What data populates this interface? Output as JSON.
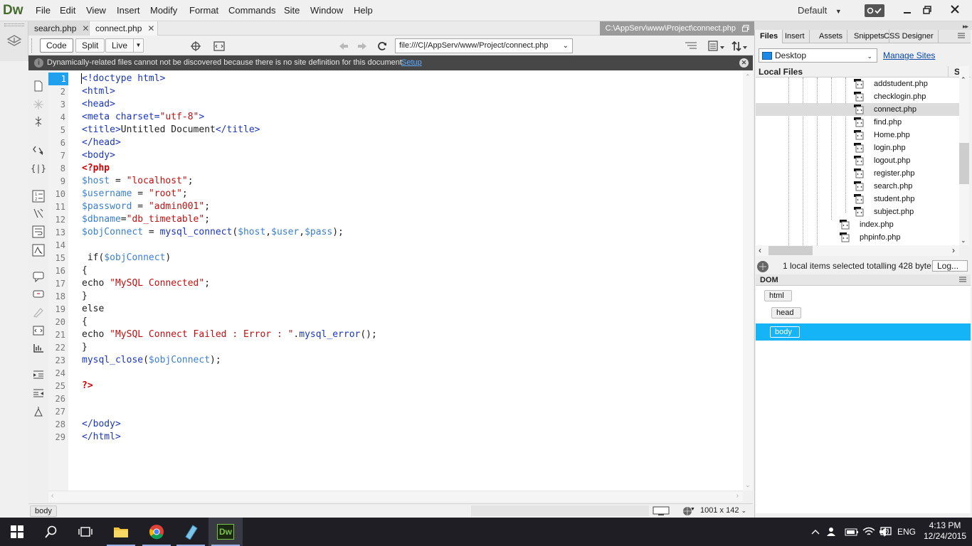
{
  "app": {
    "logo": "Dw"
  },
  "menu": [
    "File",
    "Edit",
    "View",
    "Insert",
    "Modify",
    "Format",
    "Commands",
    "Site",
    "Window",
    "Help"
  ],
  "workspace": {
    "label": "Default"
  },
  "tabs": [
    {
      "label": "search.php",
      "active": false
    },
    {
      "label": "connect.php",
      "active": true
    }
  ],
  "filepath": "C:\\AppServ\\www\\Project\\connect.php",
  "toolbar": {
    "code_label": "Code",
    "split_label": "Split",
    "live_label": "Live",
    "address": "file:///C|/AppServ/www/Project/connect.php"
  },
  "infobar": {
    "message": "Dynamically-related files cannot not be discovered because there is no site definition for this document.",
    "link": "Setup"
  },
  "editor": {
    "current_line": 1,
    "line_numbers": [
      "1",
      "2",
      "3",
      "4",
      "5",
      "6",
      "7",
      "8",
      "9",
      "10",
      "11",
      "12",
      "13",
      "14",
      "15",
      "16",
      "17",
      "18",
      "19",
      "20",
      "21",
      "22",
      "23",
      "24",
      "25",
      "26",
      "27",
      "28",
      "29"
    ],
    "lines": [
      [
        {
          "t": "<!doctype html>",
          "c": "tag"
        }
      ],
      [
        {
          "t": "<html>",
          "c": "tag"
        }
      ],
      [
        {
          "t": "<head>",
          "c": "tag"
        }
      ],
      [
        {
          "t": "<meta charset=",
          "c": "tag"
        },
        {
          "t": "\"utf-8\"",
          "c": "str"
        },
        {
          "t": ">",
          "c": "tag"
        }
      ],
      [
        {
          "t": "<title>",
          "c": "tag"
        },
        {
          "t": "Untitled Document",
          "c": "plain"
        },
        {
          "t": "</title>",
          "c": "tag"
        }
      ],
      [
        {
          "t": "</head>",
          "c": "tag"
        }
      ],
      [
        {
          "t": "<body>",
          "c": "tag"
        }
      ],
      [
        {
          "t": "<?php",
          "c": "php"
        }
      ],
      [
        {
          "t": "$host",
          "c": "var"
        },
        {
          "t": " = ",
          "c": "plain"
        },
        {
          "t": "\"localhost\"",
          "c": "str"
        },
        {
          "t": ";",
          "c": "plain"
        }
      ],
      [
        {
          "t": "$username",
          "c": "var"
        },
        {
          "t": " = ",
          "c": "plain"
        },
        {
          "t": "\"root\"",
          "c": "str"
        },
        {
          "t": ";",
          "c": "plain"
        }
      ],
      [
        {
          "t": "$password",
          "c": "var"
        },
        {
          "t": " = ",
          "c": "plain"
        },
        {
          "t": "\"admin001\"",
          "c": "str"
        },
        {
          "t": ";",
          "c": "plain"
        }
      ],
      [
        {
          "t": "$dbname",
          "c": "var"
        },
        {
          "t": "=",
          "c": "plain"
        },
        {
          "t": "\"db_timetable\"",
          "c": "str"
        },
        {
          "t": ";",
          "c": "plain"
        }
      ],
      [
        {
          "t": "$objConnect",
          "c": "var"
        },
        {
          "t": " = ",
          "c": "plain"
        },
        {
          "t": "mysql_connect",
          "c": "fn"
        },
        {
          "t": "(",
          "c": "plain"
        },
        {
          "t": "$host",
          "c": "var"
        },
        {
          "t": ",",
          "c": "plain"
        },
        {
          "t": "$user",
          "c": "var"
        },
        {
          "t": ",",
          "c": "plain"
        },
        {
          "t": "$pass",
          "c": "var"
        },
        {
          "t": ");",
          "c": "plain"
        }
      ],
      [],
      [
        {
          "t": " if(",
          "c": "plain"
        },
        {
          "t": "$objConnect",
          "c": "var"
        },
        {
          "t": ")",
          "c": "plain"
        }
      ],
      [
        {
          "t": "{",
          "c": "plain"
        }
      ],
      [
        {
          "t": "echo ",
          "c": "plain"
        },
        {
          "t": "\"MySQL Connected\"",
          "c": "str"
        },
        {
          "t": ";",
          "c": "plain"
        }
      ],
      [
        {
          "t": "}",
          "c": "plain"
        }
      ],
      [
        {
          "t": "else",
          "c": "plain"
        }
      ],
      [
        {
          "t": "{",
          "c": "plain"
        }
      ],
      [
        {
          "t": "echo ",
          "c": "plain"
        },
        {
          "t": "\"MySQL Connect Failed : Error : \"",
          "c": "str"
        },
        {
          "t": ".",
          "c": "plain"
        },
        {
          "t": "mysql_error",
          "c": "fn"
        },
        {
          "t": "();",
          "c": "plain"
        }
      ],
      [
        {
          "t": "}",
          "c": "plain"
        }
      ],
      [
        {
          "t": "mysql_close",
          "c": "fn"
        },
        {
          "t": "(",
          "c": "plain"
        },
        {
          "t": "$objConnect",
          "c": "var"
        },
        {
          "t": ");",
          "c": "plain"
        }
      ],
      [],
      [
        {
          "t": "?>",
          "c": "php"
        }
      ],
      [],
      [],
      [
        {
          "t": "</body>",
          "c": "tag"
        }
      ],
      [
        {
          "t": "</html>",
          "c": "tag"
        }
      ]
    ]
  },
  "status": {
    "tag": "body",
    "dimensions": "1001 x 142"
  },
  "panel": {
    "tabs": [
      "Files",
      "Insert",
      "Assets",
      "Snippets",
      "CSS Designer"
    ],
    "site": "Desktop",
    "manage_sites": "Manage Sites",
    "local_files_header": "Local Files",
    "size_header": "S",
    "files": [
      {
        "name": "addstudent.php",
        "selected": false,
        "indent": 2
      },
      {
        "name": "checklogin.php",
        "selected": false,
        "indent": 2
      },
      {
        "name": "connect.php",
        "selected": true,
        "indent": 2
      },
      {
        "name": "find.php",
        "selected": false,
        "indent": 2
      },
      {
        "name": "Home.php",
        "selected": false,
        "indent": 2
      },
      {
        "name": "login.php",
        "selected": false,
        "indent": 2
      },
      {
        "name": "logout.php",
        "selected": false,
        "indent": 2
      },
      {
        "name": "register.php",
        "selected": false,
        "indent": 2
      },
      {
        "name": "search.php",
        "selected": false,
        "indent": 2
      },
      {
        "name": "student.php",
        "selected": false,
        "indent": 2
      },
      {
        "name": "subject.php",
        "selected": false,
        "indent": 2
      },
      {
        "name": "index.php",
        "selected": false,
        "indent": 1
      },
      {
        "name": "phpinfo.php",
        "selected": false,
        "indent": 1
      }
    ],
    "files_status": "1 local items selected totalling 428 byte:",
    "log_button": "Log...",
    "dom_header": "DOM",
    "dom_nodes": [
      "html",
      "head",
      "body"
    ]
  },
  "taskbar": {
    "time": "4:13 PM",
    "date": "12/24/2015",
    "lang": "ENG"
  },
  "colors": {
    "accent_blue": "#21a0f0",
    "dom_selected": "#14b4f6",
    "dw_green": "#456b2d",
    "taskbar": "#1e1e24"
  }
}
